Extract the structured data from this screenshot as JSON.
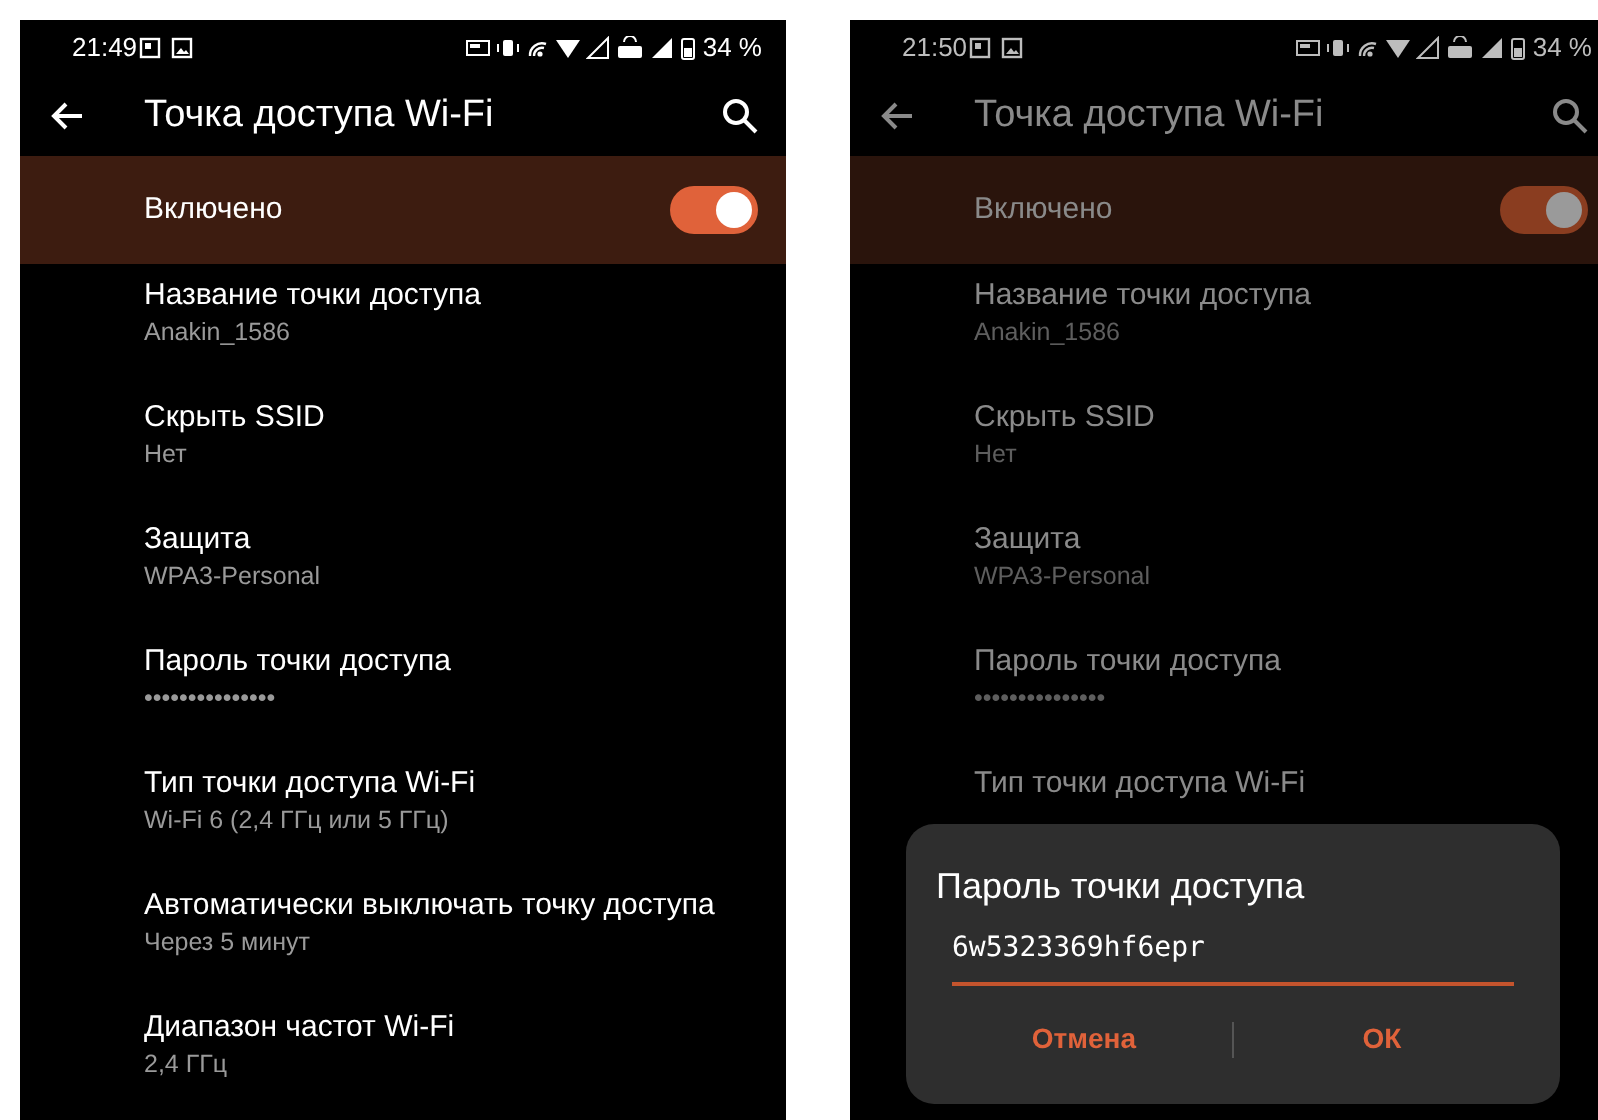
{
  "screens": [
    {
      "time": "21:49",
      "battery": "34 %",
      "title": "Точка доступа Wi-Fi",
      "dimmed": false,
      "toggle": {
        "label": "Включено",
        "on": true
      },
      "items": [
        {
          "title": "Название точки доступа",
          "subtitle": "Anakin_1586"
        },
        {
          "title": "Скрыть SSID",
          "subtitle": "Нет"
        },
        {
          "title": "Защита",
          "subtitle": "WPA3-Personal"
        },
        {
          "title": "Пароль точки доступа",
          "subtitle": "•••••••••••••••"
        },
        {
          "title": "Тип точки доступа Wi-Fi",
          "subtitle": "Wi-Fi 6 (2,4 ГГц или 5 ГГц)"
        },
        {
          "title": "Автоматически выключать точку доступа",
          "subtitle": "Через 5 минут"
        },
        {
          "title": "Диапазон частот Wi-Fi",
          "subtitle": "2,4 ГГц"
        }
      ]
    },
    {
      "time": "21:50",
      "battery": "34 %",
      "title": "Точка доступа Wi-Fi",
      "dimmed": true,
      "toggle": {
        "label": "Включено",
        "on": true
      },
      "items": [
        {
          "title": "Название точки доступа",
          "subtitle": "Anakin_1586"
        },
        {
          "title": "Скрыть SSID",
          "subtitle": "Нет"
        },
        {
          "title": "Защита",
          "subtitle": "WPA3-Personal"
        },
        {
          "title": "Пароль точки доступа",
          "subtitle": "•••••••••••••••"
        },
        {
          "title": "Тип точки доступа Wi-Fi"
        }
      ],
      "dialog": {
        "title": "Пароль точки доступа",
        "value": "6w5323369hf6epr",
        "buttons": [
          "Отмена",
          "ОК"
        ]
      }
    }
  ]
}
